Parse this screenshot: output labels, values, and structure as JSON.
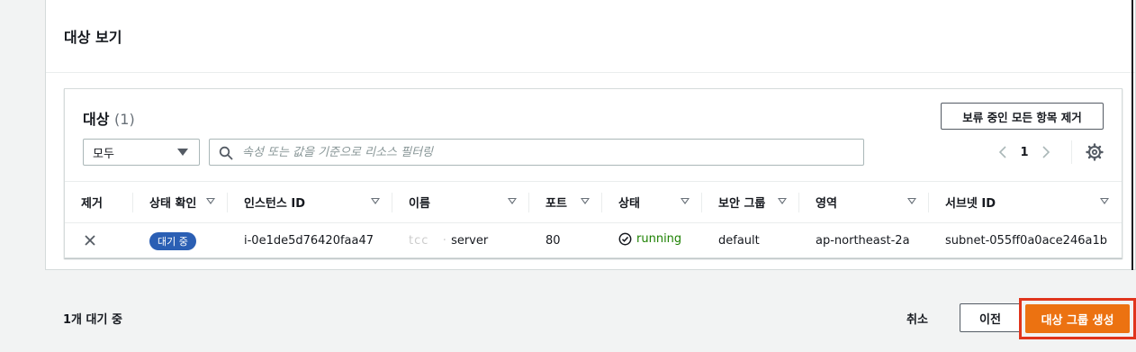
{
  "panel": {
    "title": "대상 보기"
  },
  "card": {
    "title": "대상",
    "count": "(1)",
    "deregister_label": "보류 중인 모든 항목 제거",
    "filter": {
      "selected": "모두"
    },
    "search": {
      "placeholder": "속성 또는 값을 기준으로 리소스 필터링"
    },
    "pager": {
      "page": "1"
    }
  },
  "table": {
    "columns": [
      "제거",
      "상태 확인",
      "인스턴스 ID",
      "이름",
      "포트",
      "상태",
      "보안 그룹",
      "영역",
      "서브넷 ID"
    ],
    "rows": [
      {
        "health": "대기 중",
        "instance_id": "i-0e1de5d76420faa47",
        "name_redacted": "tcc   ·",
        "name_suffix": "server",
        "port": "80",
        "state": "running",
        "security_group": "default",
        "zone": "ap-northeast-2a",
        "subnet": "subnet-055ff0a0ace246a1b"
      }
    ]
  },
  "footer": {
    "pending_text": "1개 대기 중",
    "cancel_label": "취소",
    "prev_label": "이전",
    "create_label": "대상 그룹 생성"
  },
  "colors": {
    "primary": "#ec7211",
    "running": "#1d8102",
    "pill": "#2b5fb4",
    "highlight": "#e0341c"
  }
}
